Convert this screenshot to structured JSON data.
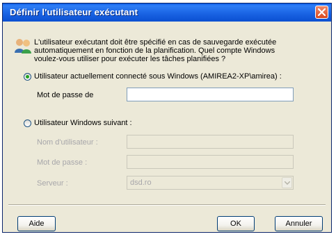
{
  "window": {
    "title": "Définir l'utilisateur exécutant"
  },
  "intro_text": "L'utilisateur exécutant doit être spécifié en cas de sauvegarde exécutée automatiquement en fonction de la planification. Quel compte Windows voulez-vous utiliser pour exécuter les tâches planifiées ?",
  "option_current": {
    "label": "Utilisateur actuellement connecté sous Windows (AMIREA2-XP\\amirea) :",
    "checked": true,
    "password_label": "Mot de passe de",
    "password_value": ""
  },
  "option_other": {
    "label": "Utilisateur Windows suivant :",
    "checked": false,
    "username_label": "Nom d'utilisateur :",
    "username_value": "",
    "password_label": "Mot de passe :",
    "password_value": "",
    "server_label": "Serveur :",
    "server_value": "dsd.ro"
  },
  "buttons": {
    "help": "Aide",
    "ok": "OK",
    "cancel": "Annuler"
  },
  "colors": {
    "title_bar": "#1a64e4",
    "panel": "#ece9d8",
    "close": "#d9481f"
  }
}
